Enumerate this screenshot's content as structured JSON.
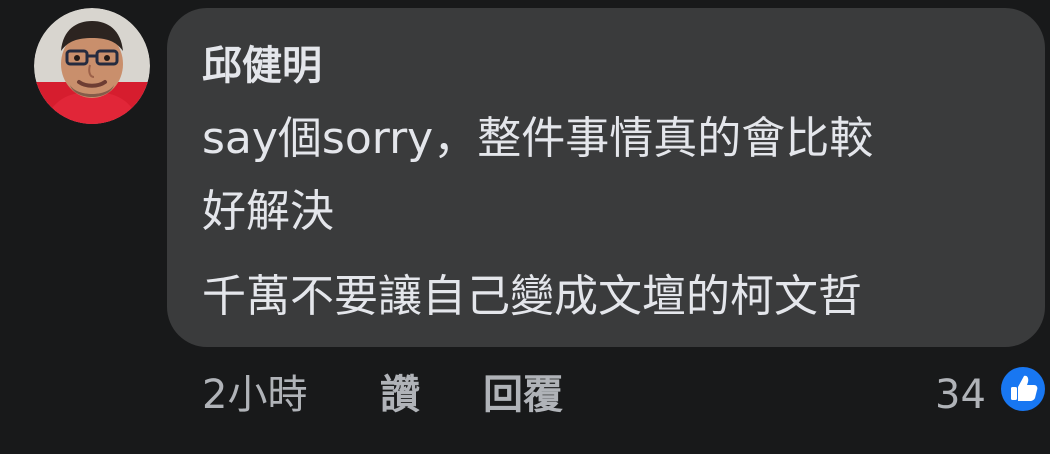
{
  "comment": {
    "author": "邱健明",
    "text_lines": [
      "say個sorry，整件事情真的會比較",
      "好解決",
      "千萬不要讓自己變成文壇的柯文哲"
    ],
    "meta": {
      "time": "2小時",
      "like_label": "讚",
      "reply_label": "回覆"
    },
    "reactions": {
      "count": "34",
      "icon": "thumbs-up-icon"
    }
  },
  "colors": {
    "background": "#18191a",
    "bubble": "#3a3b3c",
    "primary_text": "#e4e6eb",
    "secondary_text": "#b0b3b8",
    "like_blue": "#1877f2"
  }
}
